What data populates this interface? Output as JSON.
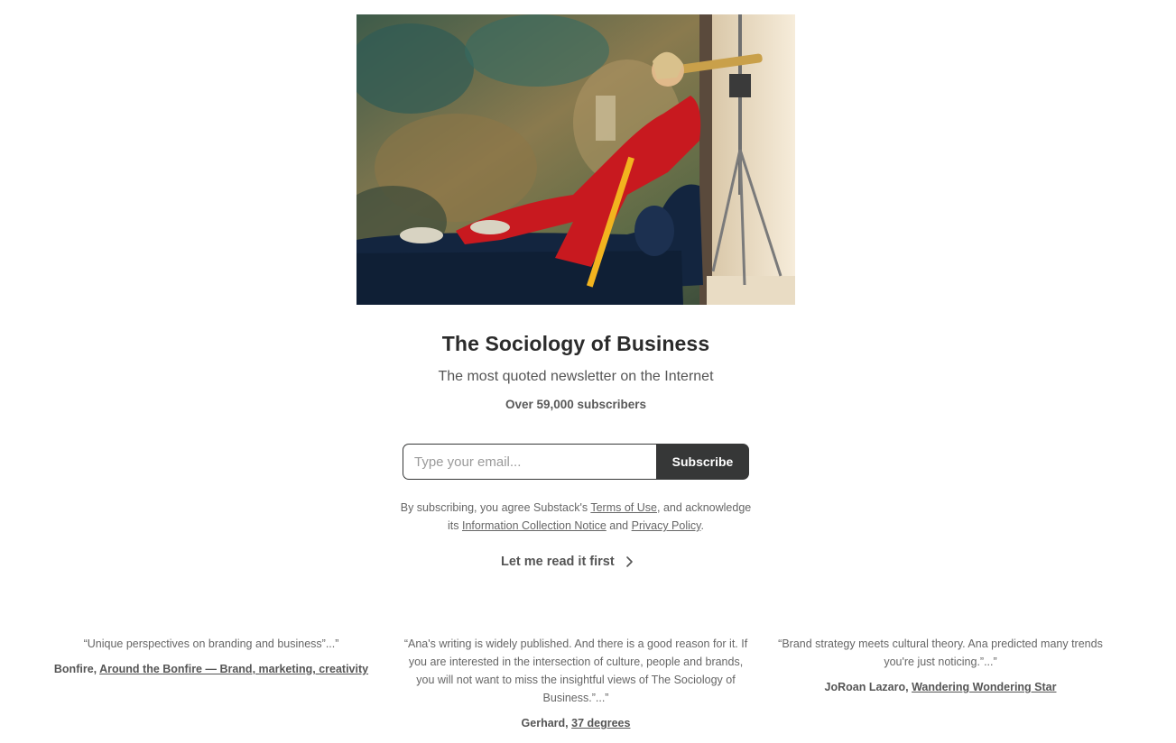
{
  "publication": {
    "title": "The Sociology of Business",
    "tagline": "The most quoted newsletter on the Internet",
    "subscribers": "Over 59,000 subscribers"
  },
  "subscribe_form": {
    "email_placeholder": "Type your email...",
    "button_label": "Subscribe"
  },
  "legal": {
    "prefix": "By subscribing, you agree Substack's ",
    "terms_link": "Terms of Use",
    "middle": ", and acknowledge its ",
    "info_link": "Information Collection Notice",
    "and": " and ",
    "privacy_link": "Privacy Policy",
    "suffix": "."
  },
  "read_first": {
    "label": "Let me read it first",
    "icon": "chevron-right-icon"
  },
  "testimonials": [
    {
      "quote": "“Unique perspectives on branding and business”...”",
      "author": "Bonfire, ",
      "link": "Around the Bonfire — Brand, marketing, creativity"
    },
    {
      "quote": "“Ana's writing is widely published. And there is a good reason for it. If you are interested in the intersection of culture, people and brands, you will not want to miss the insightful views of The Sociology of Business.”...”",
      "author": "Gerhard, ",
      "link": "37 degrees"
    },
    {
      "quote": "“Brand strategy meets cultural theory. Ana predicted many trends you're just noticing.”...”",
      "author": "JoRoan Lazaro, ",
      "link": "Wandering Wondering Star"
    }
  ],
  "colors": {
    "button_bg": "#363737",
    "text": "#363737",
    "muted": "#666666"
  }
}
